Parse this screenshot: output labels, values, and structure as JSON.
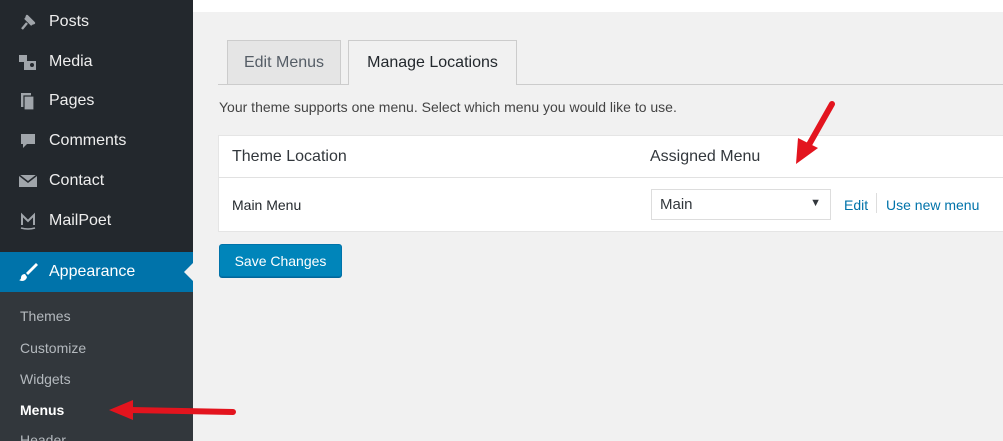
{
  "sidebar": {
    "items": [
      {
        "label": "Posts",
        "icon": "pin-icon"
      },
      {
        "label": "Media",
        "icon": "media-icon"
      },
      {
        "label": "Pages",
        "icon": "pages-icon"
      },
      {
        "label": "Comments",
        "icon": "comments-icon"
      },
      {
        "label": "Contact",
        "icon": "envelope-icon"
      },
      {
        "label": "MailPoet",
        "icon": "mailpoet-icon"
      },
      {
        "label": "Appearance",
        "icon": "paintbrush-icon"
      }
    ],
    "submenu": [
      "Themes",
      "Customize",
      "Widgets",
      "Menus",
      "Header"
    ]
  },
  "tabs": {
    "edit": "Edit Menus",
    "manage": "Manage Locations"
  },
  "description": "Your theme supports one menu. Select which menu you would like to use.",
  "table": {
    "col_location": "Theme Location",
    "col_assigned": "Assigned Menu",
    "row_label": "Main Menu",
    "selected_menu": "Main",
    "link_edit": "Edit",
    "link_new": "Use new menu"
  },
  "save_button": "Save Changes",
  "colors": {
    "sidebar_bg": "#23282d",
    "accent": "#0073aa",
    "arrow": "#e3141e"
  }
}
